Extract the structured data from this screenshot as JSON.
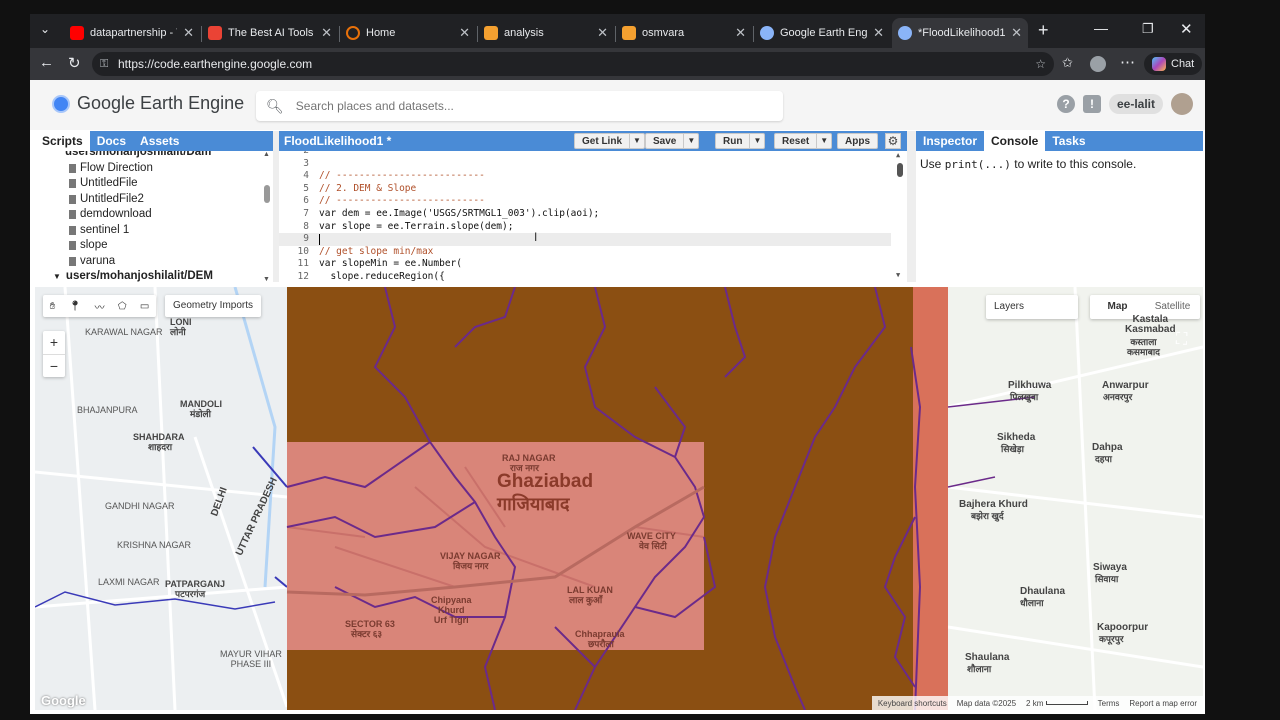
{
  "browser": {
    "tabs": [
      {
        "title": "datapartnership - Yo",
        "icon": "youtube-icon",
        "color": "#ff0000"
      },
      {
        "title": "The Best AI Tools for",
        "icon": "gmail-icon",
        "color": "#ea4335"
      },
      {
        "title": "Home",
        "icon": "spinner-icon",
        "color": "#e8710a"
      },
      {
        "title": "analysis",
        "icon": "doc-icon",
        "color": "#f4a030"
      },
      {
        "title": "osmvara",
        "icon": "doc-icon",
        "color": "#f4a030"
      },
      {
        "title": "Google Earth Engine",
        "icon": "gee-icon",
        "color": "#8ab4f8"
      },
      {
        "title": "*FloodLikelihood1",
        "icon": "gee-icon",
        "color": "#8ab4f8"
      }
    ],
    "url": "https://code.earthengine.google.com",
    "chat_label": "Chat"
  },
  "header": {
    "title": "Google Earth Engine",
    "search_placeholder": "Search places and datasets...",
    "user": "ee-lalit"
  },
  "left_panel": {
    "tabs": [
      "Scripts",
      "Docs",
      "Assets"
    ],
    "selected_tab": "Scripts",
    "tree": [
      {
        "label": "users/mohanjoshilalit/Dam",
        "type": "folder"
      },
      {
        "label": "Flow Direction",
        "type": "file"
      },
      {
        "label": "UntitledFile",
        "type": "file"
      },
      {
        "label": "UntitledFile2",
        "type": "file"
      },
      {
        "label": "demdownload",
        "type": "file"
      },
      {
        "label": "sentinel 1",
        "type": "file"
      },
      {
        "label": "slope",
        "type": "file"
      },
      {
        "label": "varuna",
        "type": "file"
      },
      {
        "label": "users/mohanjoshilalit/DEM",
        "type": "folder"
      }
    ]
  },
  "editor": {
    "script_name": "FloodLikelihood1 *",
    "buttons": {
      "get_link": "Get Link",
      "save": "Save",
      "run": "Run",
      "reset": "Reset",
      "apps": "Apps"
    },
    "lines": [
      {
        "n": "2",
        "text": ""
      },
      {
        "n": "3",
        "text": ""
      },
      {
        "n": "4",
        "text": "// --------------------------"
      },
      {
        "n": "5",
        "text": "// 2. DEM & Slope"
      },
      {
        "n": "6",
        "text": "// --------------------------"
      },
      {
        "n": "7",
        "text": "var dem = ee.Image('USGS/SRTMGL1_003').clip(aoi);"
      },
      {
        "n": "8",
        "text": "var slope = ee.Terrain.slope(dem);"
      },
      {
        "n": "9",
        "text": ""
      },
      {
        "n": "10",
        "text": "// get slope min/max"
      },
      {
        "n": "11",
        "text": "var slopeMin = ee.Number("
      },
      {
        "n": "12",
        "text": "  slope.reduceRegion({"
      }
    ]
  },
  "right_panel": {
    "tabs": [
      "Inspector",
      "Console",
      "Tasks"
    ],
    "selected_tab": "Console",
    "console_prefix": "Use ",
    "console_code": "print(...)",
    "console_suffix": " to write to this console."
  },
  "map": {
    "geometry_imports": "Geometry Imports",
    "layers": "Layers",
    "map_type_options": [
      "Map",
      "Satellite"
    ],
    "selected_map_type": "Map",
    "zoom_in": "+",
    "zoom_out": "−",
    "labels": {
      "ghaziabad_en": "Ghaziabad",
      "ghaziabad_hi": "गाजियाबाद",
      "raj_nagar": "RAJ NAGAR",
      "raj_nagar_hi": "राज नगर",
      "vijay_nagar": "VIJAY NAGAR",
      "vijay_nagar_hi": "विजय नगर",
      "wave_city": "WAVE CITY",
      "wave_city_hi": "वेव सिटी",
      "lal_kuan": "LAL KUAN",
      "lal_kuan_hi": "लाल कुआँ",
      "sector_63": "SECTOR 63",
      "sector_63_hi": "सेक्टर ६३",
      "chipyana": "Chipyana\nKhurd\nUrf Tigri",
      "chhapraula": "Chhapraula",
      "chhapraula_hi": "छपरौला",
      "shahdara": "SHAHDARA",
      "shahdara_hi": "शाहदरा",
      "mandoli": "MANDOLI",
      "mandoli_hi": "मंडोली",
      "patparganj": "PATPARGANJ",
      "patparganj_hi": "पटपरगंज",
      "gandhi_nagar": "GANDHI NAGAR",
      "krishna_nagar": "KRISHNA NAGAR",
      "laxmi_nagar": "LAXMI NAGAR",
      "mayur_vihar": "MAYUR VIHAR\nPHASE III",
      "delhi": "DELHI",
      "uttar_pradesh": "UTTAR PRADESH",
      "karawal_nagar": "KARAWAL NAGAR",
      "loni": "LONI",
      "loni_hi": "लोनी",
      "bhajanpura": "BHAJANPURA",
      "pilkhuwa": "Pilkhuwa",
      "pilkhuwa_hi": "पिलखुवा",
      "anwarpur": "Anwarpur",
      "anwarpur_hi": "अनवरपुर",
      "sikheda": "Sikheda",
      "sikheda_hi": "सिखेड़ा",
      "dahpa": "Dahpa",
      "dahpa_hi": "दहपा",
      "bajhera_khurd": "Bajhera Khurd",
      "bajhera_khurd_hi": "बझेरा खुर्द",
      "siwaya": "Siwaya",
      "siwaya_hi": "सिवाया",
      "dhaulana": "Dhaulana",
      "dhaulana_hi": "धौलाना",
      "kapoorpur": "Kapoorpur",
      "kapoorpur_hi": "कपूरपुर",
      "shaulana": "Shaulana",
      "shaulana_hi": "शौलाना",
      "kastala": "Kastala\nKasmabad",
      "kastala_hi": "कस्ताला\nकसमाबाद"
    },
    "footer": {
      "shortcuts": "Keyboard shortcuts",
      "data": "Map data ©2025",
      "scale": "2 km",
      "terms": "Terms",
      "report": "Report a map error"
    },
    "google": "Google"
  }
}
